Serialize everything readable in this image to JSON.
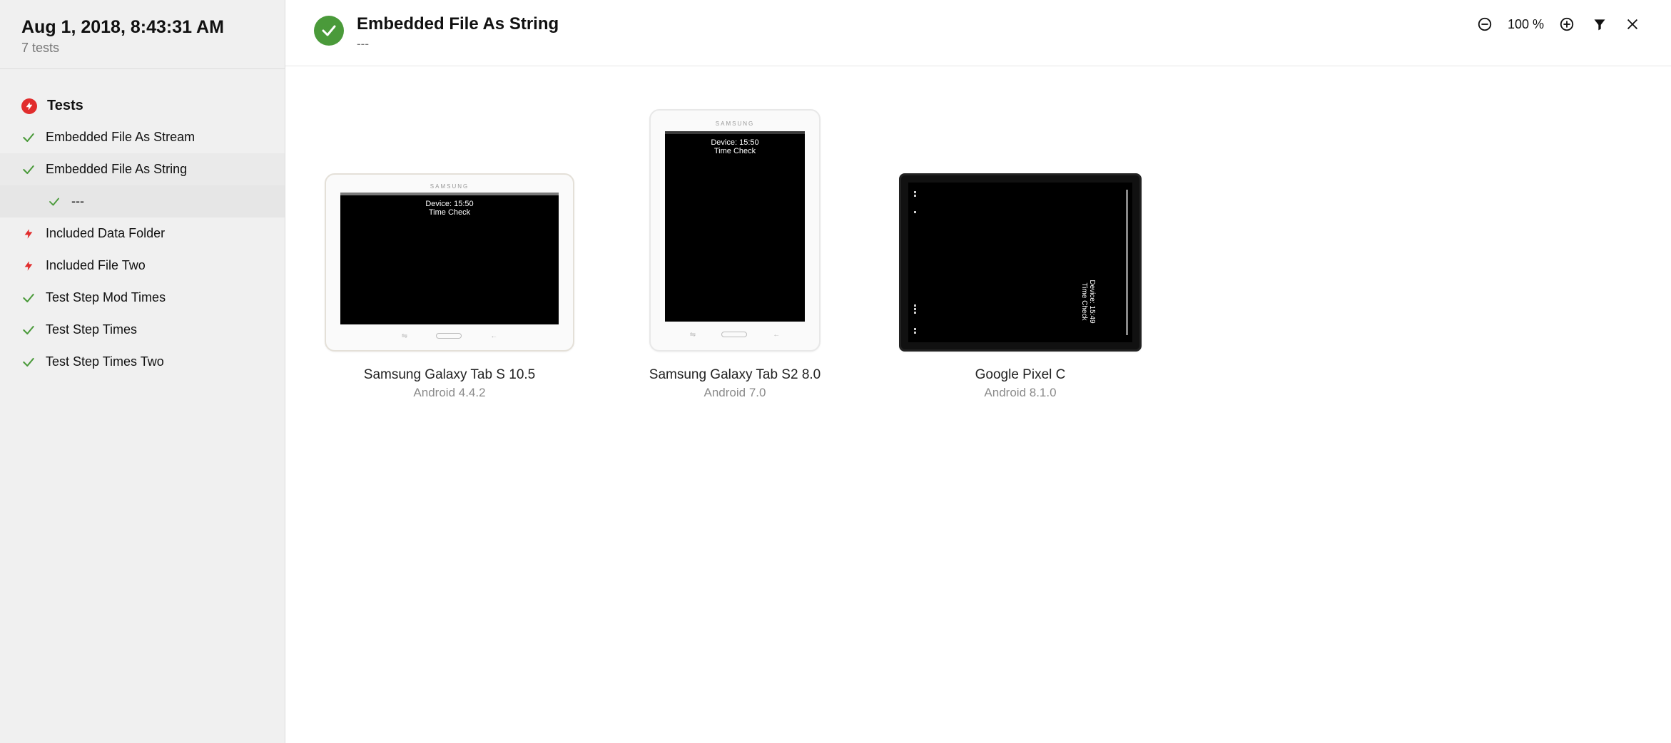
{
  "sidebar": {
    "title": "Aug 1, 2018, 8:43:31 AM",
    "subtitle": "7 tests",
    "section_label": "Tests",
    "items": [
      {
        "label": "Embedded File As Stream",
        "status": "pass"
      },
      {
        "label": "Embedded File As String",
        "status": "pass",
        "active": true,
        "children": [
          {
            "label": "---",
            "status": "pass"
          }
        ]
      },
      {
        "label": "Included Data Folder",
        "status": "fail"
      },
      {
        "label": "Included File Two",
        "status": "fail"
      },
      {
        "label": "Test Step Mod Times",
        "status": "pass"
      },
      {
        "label": "Test Step Times",
        "status": "pass"
      },
      {
        "label": "Test Step Times Two",
        "status": "pass"
      }
    ]
  },
  "topbar": {
    "title": "Embedded File As String",
    "subtitle": "---",
    "zoom": "100 %"
  },
  "devices": [
    {
      "name": "Samsung Galaxy Tab S 10.5",
      "os": "Android 4.4.2",
      "brand": "SAMSUNG",
      "screen_line1": "Device: 15:50",
      "screen_line2": "Time Check",
      "status_left": "",
      "status_right": ""
    },
    {
      "name": "Samsung Galaxy Tab S2 8.0",
      "os": "Android 7.0",
      "brand": "SAMSUNG",
      "screen_line1": "Device: 15:50",
      "screen_line2": "Time Check",
      "status_left": "",
      "status_right": ""
    },
    {
      "name": "Google Pixel C",
      "os": "Android 8.1.0",
      "brand": "",
      "screen_line1": "Device: 15:49",
      "screen_line2": "Time Check",
      "status_left": "",
      "status_right": ""
    }
  ]
}
